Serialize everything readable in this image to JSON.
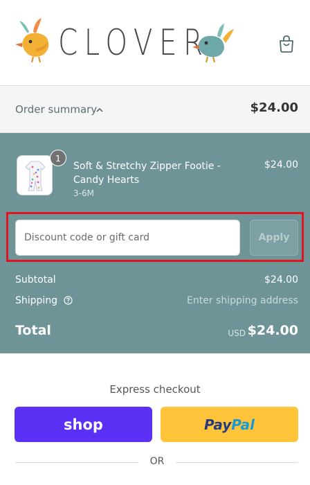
{
  "header": {
    "brand": "CLOVER",
    "bag_icon": "shopping-bag-icon",
    "colors": {
      "bird_left": "#f2b134",
      "bird_right": "#6fa8a8",
      "text": "#4a4a4a"
    }
  },
  "summary": {
    "label": "Order summary",
    "chevron_icon": "chevron-up-icon",
    "total": "$24.00"
  },
  "item": {
    "quantity": "1",
    "name": "Soft & Stretchy Zipper Footie - Candy Hearts",
    "variant": "3-6M",
    "price": "$24.00"
  },
  "discount": {
    "placeholder": "Discount code or gift card",
    "apply_label": "Apply",
    "highlight_color": "#e0141e"
  },
  "totals": {
    "subtotal_label": "Subtotal",
    "subtotal_value": "$24.00",
    "shipping_label": "Shipping",
    "shipping_value": "Enter shipping address",
    "total_label": "Total",
    "currency": "USD",
    "total_value": "$24.00"
  },
  "express": {
    "title": "Express checkout",
    "shop_label": "shop",
    "paypal_label_1": "Pay",
    "paypal_label_2": "Pal",
    "or_label": "OR",
    "colors": {
      "shop": "#5a31f4",
      "paypal": "#ffc439"
    }
  },
  "panel_color": "#6f9498"
}
